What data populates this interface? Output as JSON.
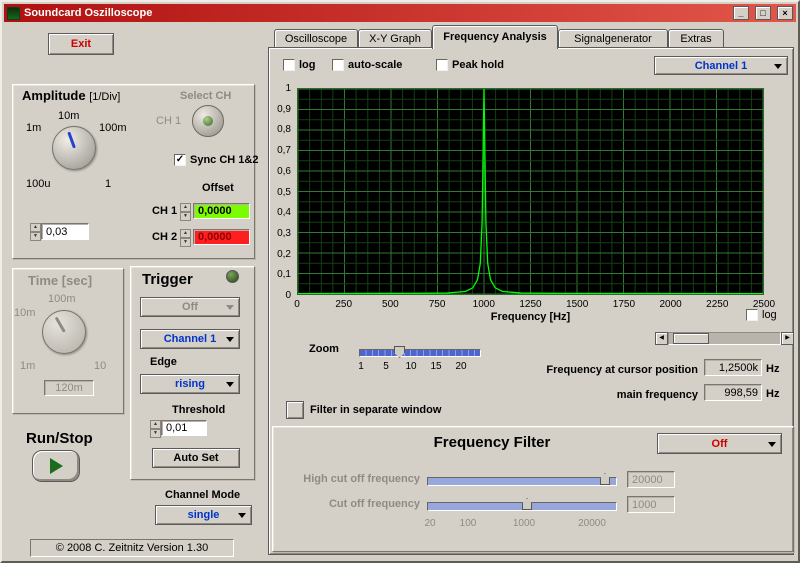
{
  "window": {
    "title": "Soundcard Oszilloscope",
    "buttons": {
      "minimize": "_",
      "maximize": "□",
      "close": "×"
    }
  },
  "colors": {
    "accent_blue": "#0033cc",
    "filter_off_red": "#cc0000",
    "offset_ch1_bg": "#7cfc00",
    "offset_ch2_bg": "#ff1f1f",
    "titlebar_red": "#b01010",
    "trace_green": "#00ff00"
  },
  "left_panel": {
    "exit_button": "Exit",
    "amplitude": {
      "title": "Amplitude",
      "unit": "[1/Div]",
      "knob_labels": {
        "top": "10m",
        "left": "1m",
        "right": "100m",
        "bottom_left": "100u",
        "bottom_right": "1"
      },
      "value": "0,03",
      "select_ch_label": "Select CH",
      "ch1_label": "CH 1",
      "sync_label": "Sync CH 1&2",
      "offset": {
        "title": "Offset",
        "ch1_label": "CH 1",
        "ch1_value": "0,0000",
        "ch2_label": "CH 2",
        "ch2_value": "0,0000"
      }
    },
    "time": {
      "title": "Time [sec]",
      "knob_labels": {
        "top": "100m",
        "left": "10m",
        "bottom_left": "1m",
        "bottom_right": "10"
      },
      "value": "120m"
    },
    "trigger": {
      "title": "Trigger",
      "mode": "Off",
      "channel": "Channel 1",
      "edge_label": "Edge",
      "edge": "rising",
      "threshold_label": "Threshold",
      "threshold_value": "0,01",
      "autoset_button": "Auto Set"
    },
    "runstop_label": "Run/Stop",
    "channel_mode_label": "Channel Mode",
    "channel_mode_value": "single",
    "copyright": "© 2008   C. Zeitnitz Version 1.30"
  },
  "tabs": [
    "Oscilloscope",
    "X-Y Graph",
    "Frequency Analysis",
    "Signalgenerator",
    "Extras"
  ],
  "active_tab": "Frequency Analysis",
  "freq_tab": {
    "log_label": "log",
    "autoscale_label": "auto-scale",
    "peakhold_label": "Peak hold",
    "channel_value": "Channel 1",
    "plot_log_label": "log",
    "zoom_label": "Zoom",
    "zoom_ticks": [
      "1",
      "5",
      "10",
      "15",
      "20"
    ],
    "cursor_freq_label": "Frequency at cursor position",
    "cursor_freq_value": "1,2500k",
    "cursor_freq_unit": "Hz",
    "main_freq_label": "main frequency",
    "main_freq_value": "998,59",
    "main_freq_unit": "Hz",
    "filter_window_label": "Filter in separate window",
    "filter": {
      "title": "Frequency Filter",
      "mode": "Off",
      "high_cut_label": "High cut off frequency",
      "high_cut_value": "20000",
      "cut_label": "Cut off frequency",
      "cut_value": "1000",
      "scale_ticks": [
        "20",
        "100",
        "1000",
        "20000"
      ]
    }
  },
  "chart_data": {
    "type": "line",
    "title": "",
    "xlabel": "Frequency [Hz]",
    "ylabel": "",
    "xlim": [
      0,
      2500
    ],
    "ylim": [
      0,
      1
    ],
    "grid": true,
    "background": "#000000",
    "grid_color": "#2f7a2f",
    "trace_color": "#00ff00",
    "x_ticks": [
      "0",
      "250",
      "500",
      "750",
      "1000",
      "1250",
      "1500",
      "1750",
      "2000",
      "2250",
      "2500"
    ],
    "y_ticks": [
      "1",
      "0,9",
      "0,8",
      "0,7",
      "0,6",
      "0,5",
      "0,4",
      "0,3",
      "0,2",
      "0,1",
      "0"
    ],
    "series": [
      {
        "name": "Channel 1",
        "peak_hz": 1000,
        "peak_amplitude": 1.0,
        "points": [
          [
            0,
            0.002
          ],
          [
            600,
            0.003
          ],
          [
            800,
            0.005
          ],
          [
            900,
            0.012
          ],
          [
            940,
            0.03
          ],
          [
            965,
            0.07
          ],
          [
            980,
            0.15
          ],
          [
            990,
            0.35
          ],
          [
            1000,
            1.0
          ],
          [
            1010,
            0.35
          ],
          [
            1020,
            0.15
          ],
          [
            1035,
            0.07
          ],
          [
            1060,
            0.03
          ],
          [
            1100,
            0.012
          ],
          [
            1200,
            0.005
          ],
          [
            1400,
            0.003
          ],
          [
            2500,
            0.002
          ]
        ]
      }
    ]
  }
}
